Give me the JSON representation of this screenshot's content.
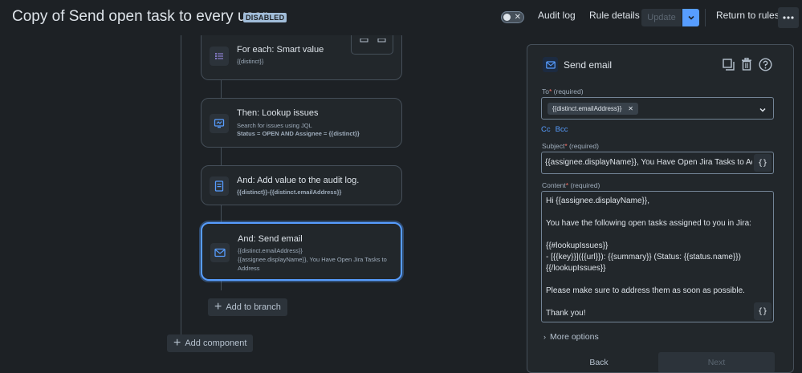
{
  "header": {
    "title": "Copy of Send open task to every user",
    "status_badge": "DISABLED",
    "audit_log": "Audit log",
    "rule_details": "Rule details",
    "update": "Update",
    "return_to_rules": "Return to rules"
  },
  "flow": {
    "foreach": {
      "title": "For each: Smart value",
      "line1": "{{distinct}}"
    },
    "lookup": {
      "title": "Then: Lookup issues",
      "line1": "Search for issues using JQL",
      "line2": "Status = OPEN AND Assignee = {{distinct}}"
    },
    "audit": {
      "title": "And: Add value to the audit log.",
      "line1": "{{distinct}}-{{distinct.emailAddress}}"
    },
    "email": {
      "title": "And: Send email",
      "line1": "{{distinct.emailAddress}}",
      "line2": "{{assignee.displayName}}, You Have Open Jira Tasks to",
      "line3": "Address"
    },
    "add_branch": "Add to branch",
    "add_component": "Add component"
  },
  "panel": {
    "title": "Send email",
    "to_label": "To",
    "to_required": "(required)",
    "to_chip": "{{distinct.emailAddress}}",
    "cc": "Cc",
    "bcc": "Bcc",
    "subject_label": "Subject",
    "subject_required": "(required)",
    "subject_value": "{{assignee.displayName}}, You Have Open Jira Tasks to Address",
    "content_label": "Content",
    "content_required": "(required)",
    "content_lines": [
      "Hi {{assignee.displayName}},",
      "",
      "You have the following open tasks assigned to you in Jira:",
      "",
      "{{#lookupIssues}}",
      "- [{{key}}]({{url}}): {{summary}} (Status: {{status.name}})",
      "{{/lookupIssues}}",
      "",
      "Please make sure to address them as soon as possible.",
      "",
      "Thank you!"
    ],
    "brace": "{}",
    "more_options": "More options",
    "back": "Back",
    "next": "Next"
  },
  "colors": {
    "accent": "#579dff",
    "background": "#1d2125",
    "card": "#22272b",
    "required": "#f87168"
  }
}
